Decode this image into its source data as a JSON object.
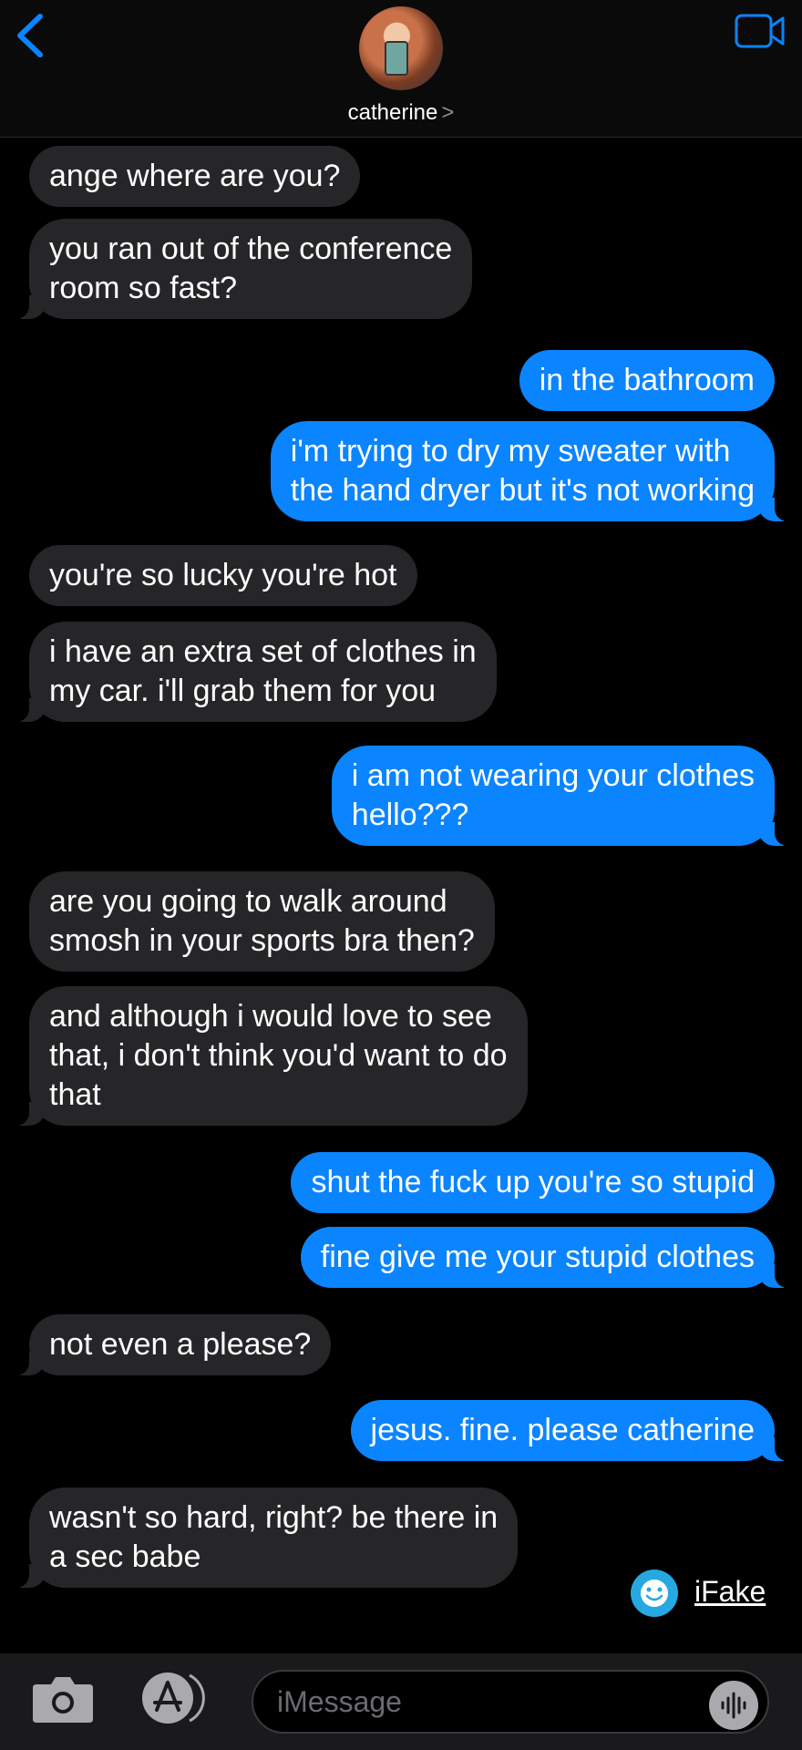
{
  "header": {
    "contact_name": "catherine",
    "chevron": ">",
    "back_icon": "chevron-left-icon",
    "video_icon": "video-camera-icon",
    "accent_color": "#0a84ff"
  },
  "messages": [
    {
      "side": "in",
      "text": "ange where are you?"
    },
    {
      "side": "in",
      "text": "you ran out of the conference\nroom so fast?"
    },
    {
      "side": "out",
      "text": "in the bathroom"
    },
    {
      "side": "out",
      "text": "i'm trying to dry my sweater with\nthe hand dryer but it's not working"
    },
    {
      "side": "in",
      "text": "you're so lucky you're hot"
    },
    {
      "side": "in",
      "text": "i have an extra set of clothes in\nmy car. i'll grab them for you"
    },
    {
      "side": "out",
      "text": "i am not wearing your clothes\nhello???"
    },
    {
      "side": "in",
      "text": "are you going to walk around\nsmosh in your sports bra then?"
    },
    {
      "side": "in",
      "text": "and although i would love to see\nthat, i don't think you'd want to do\nthat"
    },
    {
      "side": "out",
      "text": "shut the fuck up you're so stupid"
    },
    {
      "side": "out",
      "text": "fine give me your stupid clothes"
    },
    {
      "side": "in",
      "text": "not even a please?"
    },
    {
      "side": "out",
      "text": "jesus. fine. please catherine"
    },
    {
      "side": "in",
      "text": "wasn't so hard, right? be there in\na sec babe"
    }
  ],
  "watermark": {
    "label": "iFake"
  },
  "composer": {
    "placeholder": "iMessage",
    "camera_icon": "camera-icon",
    "appstore_icon": "app-store-icon",
    "audio_icon": "audio-waveform-icon"
  },
  "colors": {
    "incoming_bubble": "#262629",
    "outgoing_bubble": "#0a84ff",
    "background": "#000000"
  }
}
